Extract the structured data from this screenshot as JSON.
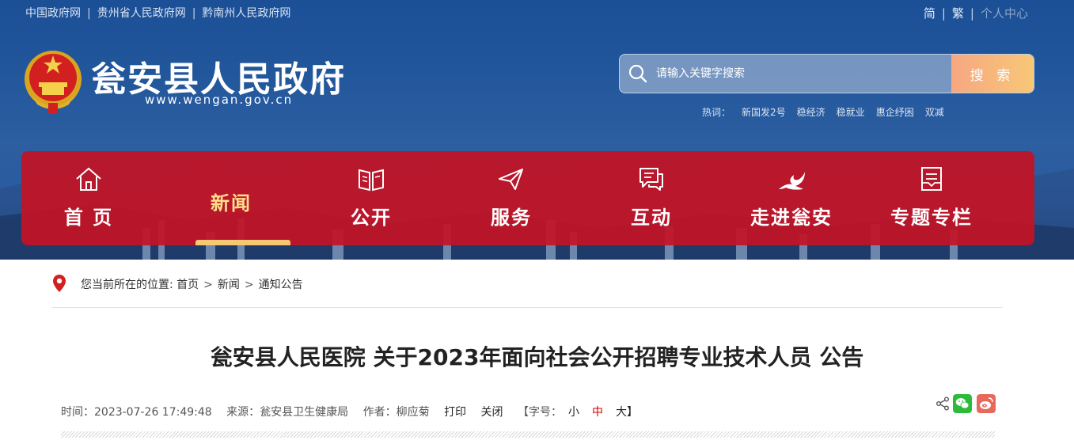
{
  "topbar": {
    "links": [
      "中国政府网",
      "贵州省人民政府网",
      "黔南州人民政府网"
    ],
    "right": {
      "simplified": "简",
      "traditional": "繁",
      "personal": "个人中心"
    }
  },
  "site": {
    "title": "瓮安县人民政府",
    "url": "www.wengan.gov.cn"
  },
  "search": {
    "placeholder": "请输入关键字搜索",
    "button": "搜 索",
    "hot_label": "热词：",
    "hot_words": [
      "新国发2号",
      "稳经济",
      "稳就业",
      "惠企纾困",
      "双减"
    ]
  },
  "nav": {
    "items": [
      {
        "label": "首 页",
        "icon": "home-icon"
      },
      {
        "label": "新闻",
        "icon": "",
        "active": true
      },
      {
        "label": "公开",
        "icon": "book-icon"
      },
      {
        "label": "服务",
        "icon": "paper-plane-icon"
      },
      {
        "label": "互动",
        "icon": "chat-icon"
      },
      {
        "label": "走进瓮安",
        "icon": "phoenix-icon"
      },
      {
        "label": "专题专栏",
        "icon": "document-icon"
      }
    ]
  },
  "breadcrumb": {
    "prefix": "您当前所在的位置:",
    "items": [
      "首页",
      "新闻",
      "通知公告"
    ]
  },
  "article": {
    "title": "瓮安县人民医院 关于2023年面向社会公开招聘专业技术人员 公告",
    "time_label": "时间：",
    "time": "2023-07-26 17:49:48",
    "source_label": "来源：",
    "source": "瓮安县卫生健康局",
    "author_label": "作者：",
    "author": "柳应菊",
    "print": "打印",
    "close": "关闭",
    "fontsize_label": "【字号：",
    "fontsize_small": "小",
    "fontsize_mid": "中",
    "fontsize_large": "大】"
  },
  "colors": {
    "nav_red": "#c41224",
    "accent_gold": "#f7c773",
    "active_red": "#d40000",
    "wechat_green": "#2dbb3b",
    "weibo_red": "#e8685c"
  }
}
